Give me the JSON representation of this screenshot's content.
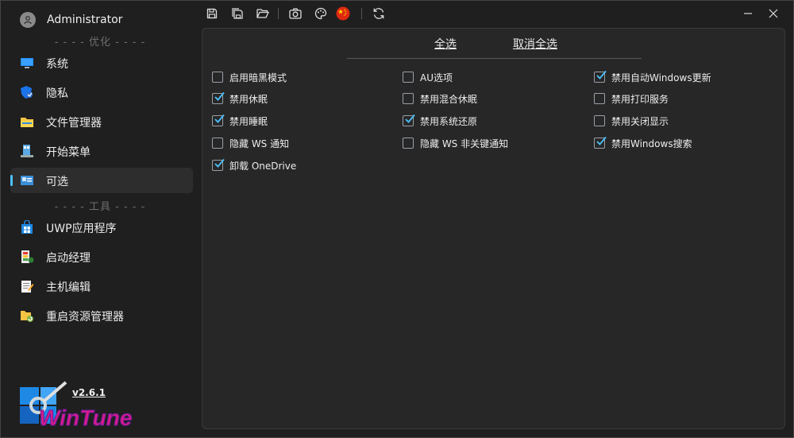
{
  "app": {
    "version": "v2.6.1",
    "logo_text": "WinTune"
  },
  "user": {
    "name": "Administrator"
  },
  "sidebar": {
    "section_optimize": "- - - - 优化 - - - -",
    "section_tools": "- - - - 工具 - - - -",
    "items": [
      {
        "label": "系统",
        "icon": "monitor-icon"
      },
      {
        "label": "隐私",
        "icon": "shield-icon"
      },
      {
        "label": "文件管理器",
        "icon": "folder-icon"
      },
      {
        "label": "开始菜单",
        "icon": "start-menu-icon"
      },
      {
        "label": "可选",
        "icon": "optional-icon",
        "active": true
      },
      {
        "label": "UWP应用程序",
        "icon": "store-icon"
      },
      {
        "label": "启动经理",
        "icon": "startup-icon"
      },
      {
        "label": "主机编辑",
        "icon": "hosts-edit-icon"
      },
      {
        "label": "重启资源管理器",
        "icon": "restart-explorer-icon"
      }
    ]
  },
  "toolbar": {
    "buttons": [
      "save-icon",
      "save-as-icon",
      "open-folder-icon",
      "screenshot-icon",
      "theme-icon",
      "china-flag-icon",
      "refresh-icon"
    ]
  },
  "colors": {
    "accent": "#4cc2ff",
    "flag_red": "#de2910",
    "flag_star": "#ffde00"
  },
  "main": {
    "select_all": "全选",
    "deselect_all": "取消全选",
    "options": [
      {
        "label": "启用暗黑模式",
        "checked": false
      },
      {
        "label": "禁用休眠",
        "checked": true
      },
      {
        "label": "禁用睡眠",
        "checked": true
      },
      {
        "label": "隐藏 WS 通知",
        "checked": false
      },
      {
        "label": "卸载 OneDrive",
        "checked": true
      },
      {
        "label": "AU选项",
        "checked": false
      },
      {
        "label": "禁用混合休眠",
        "checked": false
      },
      {
        "label": "禁用系统还原",
        "checked": true
      },
      {
        "label": "隐藏 WS 非关键通知",
        "checked": false
      },
      {
        "label": "禁用自动Windows更新",
        "checked": true
      },
      {
        "label": "禁用打印服务",
        "checked": false
      },
      {
        "label": "禁用关闭显示",
        "checked": false
      },
      {
        "label": "禁用Windows搜索",
        "checked": true
      }
    ]
  }
}
